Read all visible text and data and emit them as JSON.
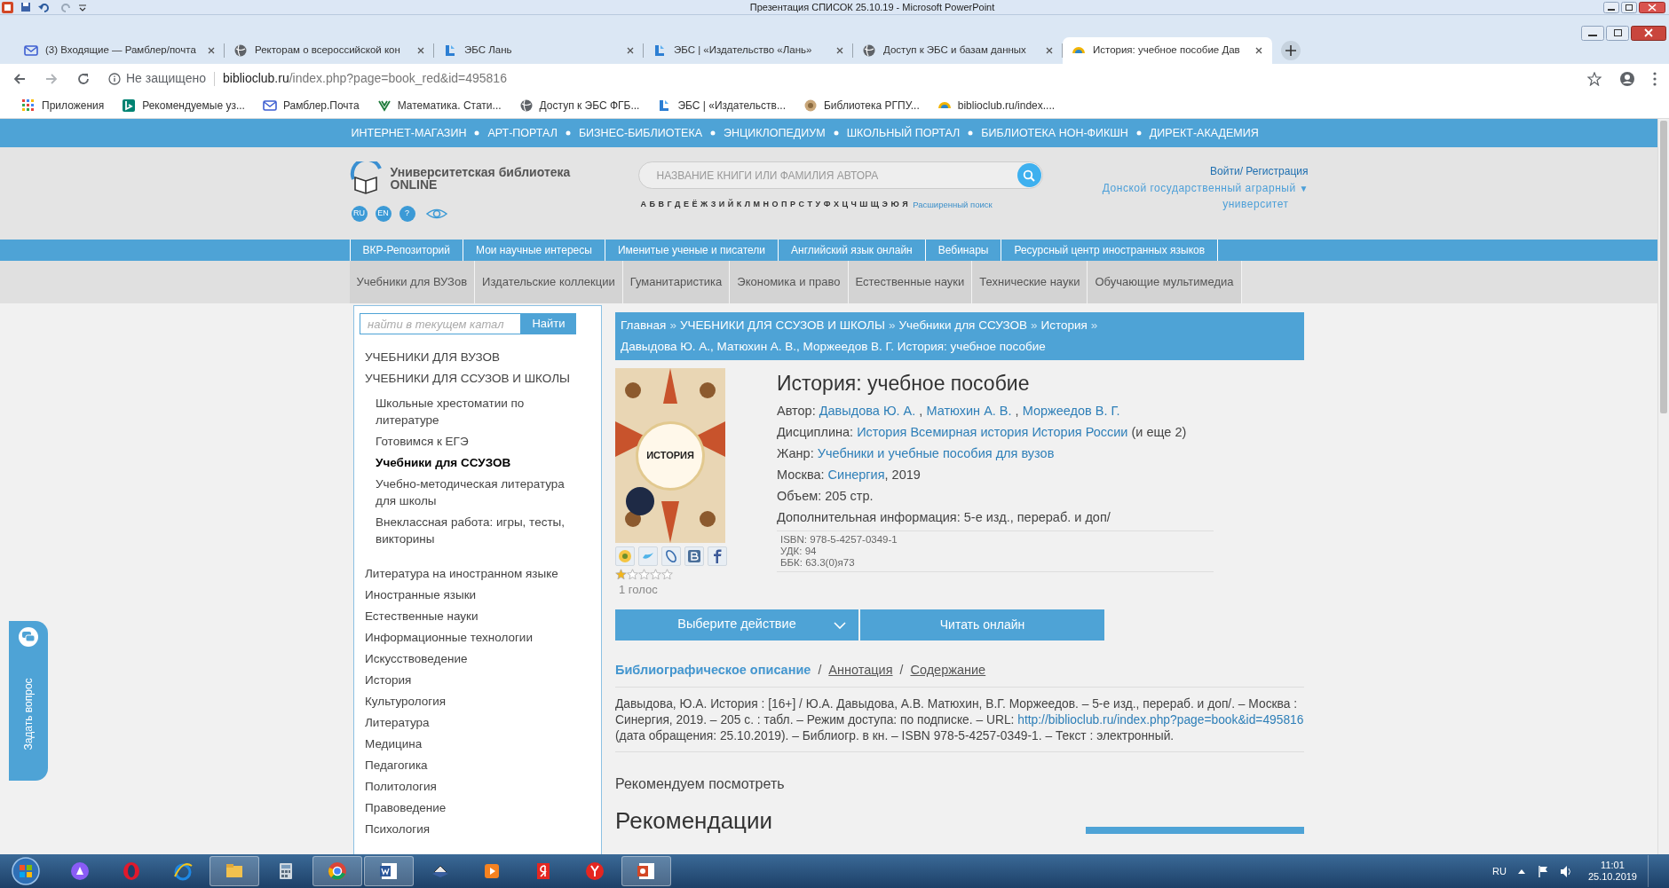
{
  "app_titlebar": {
    "title": "Презентация СПИСОК 25.10.19  -  Microsoft PowerPoint"
  },
  "browser": {
    "tabs": [
      {
        "title": "(3) Входящие — Рамблер/почта",
        "kind": "mail",
        "selected": false
      },
      {
        "title": "Ректорам о всероссийской кон",
        "kind": "globe",
        "selected": false
      },
      {
        "title": "ЭБС Лань",
        "kind": "lan",
        "selected": false
      },
      {
        "title": "ЭБС | «Издательство «Лань»",
        "kind": "lan",
        "selected": false
      },
      {
        "title": "Доступ к ЭБС и базам данных",
        "kind": "globe",
        "selected": false
      },
      {
        "title": "История: учебное пособие Дав",
        "kind": "biblio",
        "selected": true
      }
    ],
    "address": {
      "security": "Не защищено",
      "host": "biblioclub.ru",
      "path": "/index.php?page=book_red&id=495816"
    },
    "bookmarks": [
      {
        "label": "Приложения",
        "kind": "apps"
      },
      {
        "label": "Рекомендуемые уз...",
        "kind": "bing"
      },
      {
        "label": "Рамблер.Почта",
        "kind": "mail"
      },
      {
        "label": "Математика. Стати...",
        "kind": "math"
      },
      {
        "label": "Доступ к ЭБС ФГБ...",
        "kind": "globe"
      },
      {
        "label": "ЭБС | «Издательств...",
        "kind": "lan"
      },
      {
        "label": "Библиотека РГПУ...",
        "kind": "library"
      },
      {
        "label": "biblioclub.ru/index....",
        "kind": "biblio"
      }
    ]
  },
  "site": {
    "top_links": [
      "ИНТЕРНЕТ-МАГАЗИН",
      "АРТ-ПОРТАЛ",
      "БИЗНЕС-БИБЛИОТЕКА",
      "ЭНЦИКЛОПЕДИУМ",
      "ШКОЛЬНЫЙ ПОРТАЛ",
      "БИБЛИОТЕКА НОН-ФИКШН",
      "ДИРЕКТ-АКАДЕМИЯ"
    ],
    "logo": {
      "line1": "Университетская библиотека",
      "line2": "ONLINE"
    },
    "lang_buttons": [
      "RU",
      "EN",
      "?"
    ],
    "search": {
      "placeholder": "НАЗВАНИЕ КНИГИ ИЛИ ФАМИЛИЯ АВТОРА"
    },
    "alphabet": [
      "А",
      "Б",
      "В",
      "Г",
      "Д",
      "Е",
      "Ё",
      "Ж",
      "З",
      "И",
      "Й",
      "К",
      "Л",
      "М",
      "Н",
      "О",
      "П",
      "Р",
      "С",
      "Т",
      "У",
      "Ф",
      "Х",
      "Ц",
      "Ч",
      "Ш",
      "Щ",
      "Э",
      "Ю",
      "Я"
    ],
    "advanced_search": "Расширенный поиск",
    "login": "Войти/ Регистрация",
    "organization": {
      "line1": "Донской государственный аграрный",
      "caret": "▼",
      "line2": "университет"
    },
    "menu_primary": [
      "ВКР-Репозиторий",
      "Мои научные интересы",
      "Именитые ученые и писатели",
      "Английский язык онлайн",
      "Вебинары",
      "Ресурсный центр иностранных языков"
    ],
    "menu_secondary": [
      "Учебники для ВУЗов",
      "Издательские коллекции",
      "Гуманитаристика",
      "Экономика и право",
      "Естественные науки",
      "Технические науки",
      "Обучающие мультимедиа"
    ]
  },
  "sidebar": {
    "search": {
      "placeholder": "найти в текущем катал"
    },
    "search_button": "Найти",
    "categories": [
      {
        "label": "УЧЕБНИКИ ДЛЯ ВУЗОВ",
        "selected": false
      },
      {
        "label": "УЧЕБНИКИ ДЛЯ ССУЗОВ И ШКОЛЫ",
        "selected": false,
        "children": [
          {
            "label": "Школьные хрестоматии по литературе",
            "selected": false
          },
          {
            "label": "Готовимся к ЕГЭ",
            "selected": false
          },
          {
            "label": "Учебники для ССУЗОВ",
            "selected": true
          },
          {
            "label": "Учебно-методическая литература для школы",
            "selected": false
          },
          {
            "label": "Внеклассная работа: игры, тесты, викторины",
            "selected": false
          }
        ]
      },
      {
        "label": "Литература на иностранном языке",
        "selected": false
      },
      {
        "label": "Иностранные языки",
        "selected": false
      },
      {
        "label": "Естественные науки",
        "selected": false
      },
      {
        "label": "Информационные технологии",
        "selected": false
      },
      {
        "label": "Искусствоведение",
        "selected": false
      },
      {
        "label": "История",
        "selected": false
      },
      {
        "label": "Культурология",
        "selected": false
      },
      {
        "label": "Литература",
        "selected": false
      },
      {
        "label": "Медицина",
        "selected": false
      },
      {
        "label": "Педагогика",
        "selected": false
      },
      {
        "label": "Политология",
        "selected": false
      },
      {
        "label": "Правоведение",
        "selected": false
      },
      {
        "label": "Психология",
        "selected": false
      }
    ]
  },
  "breadcrumbs": {
    "separator": "»",
    "items": [
      "Главная",
      "УЧЕБНИКИ ДЛЯ ССУЗОВ И ШКОЛЫ",
      "Учебники для ССУЗОВ",
      "История",
      "Давыдова Ю. А., Матюхин А. В., Моржеедов В. Г. История: учебное пособие"
    ]
  },
  "book": {
    "cover_text": "ИСТОРИЯ",
    "title": "История: учебное пособие",
    "details": [
      {
        "label": "Автор:",
        "links": [
          "Давыдова Ю. А.",
          "Матюхин А. В.",
          "Моржеедов В. Г."
        ],
        "separator": " ,"
      },
      {
        "label": "Дисциплина:",
        "links": [
          "История",
          "Всемирная история",
          "История России"
        ],
        "suffix": " (и еще 2)"
      },
      {
        "label": "Жанр:",
        "links": [
          "Учебники и учебные пособия для вузов"
        ]
      },
      {
        "label": "Москва:",
        "links": [
          "Синергия"
        ],
        "suffix": ", 2019"
      },
      {
        "label": "Объем:",
        "value": "205 стр."
      },
      {
        "label": "Дополнительная информация:",
        "value": "5-е изд., перераб. и доп/"
      }
    ],
    "codes": [
      "ISBN: 978-5-4257-0349-1",
      "УДК: 94",
      "ББК: 63.3(0)я73"
    ],
    "stars": 1,
    "votes": "1 голос",
    "action_button": "Выберите действие",
    "read_button": "Читать онлайн"
  },
  "info_tabs": {
    "separator": "/",
    "items": [
      {
        "label": "Библиографическое описание",
        "selected": true
      },
      {
        "label": "Аннотация",
        "selected": false
      },
      {
        "label": "Содержание",
        "selected": false
      }
    ]
  },
  "citation": {
    "before": "Давыдова, Ю.А. История : [16+] / Ю.А. Давыдова, А.В. Матюхин, В.Г. Моржеедов. – 5-е изд., перераб. и доп/. – Москва : Синергия, 2019. – 205 с. : табл. – Режим доступа: по подписке. – URL: ",
    "link": "http://biblioclub.ru/index.php?page=book&id=495816",
    "after": " (дата обращения: 25.10.2019). – Библиогр. в кн. – ISBN 978-5-4257-0349-1. – Текст : электронный."
  },
  "recommend_label": "Рекомендуем посмотреть",
  "recommendations_heading": "Рекомендации",
  "feedback_tab": "Задать вопрос",
  "taskbar": {
    "apps": [
      {
        "kind": "alice",
        "running": false
      },
      {
        "kind": "opera",
        "running": false
      },
      {
        "kind": "ie",
        "running": false
      },
      {
        "kind": "explorer",
        "running": true
      },
      {
        "kind": "calculator",
        "running": false
      },
      {
        "kind": "chrome",
        "running": true
      },
      {
        "kind": "word",
        "running": true
      },
      {
        "kind": "books",
        "running": false
      },
      {
        "kind": "media",
        "running": false
      },
      {
        "kind": "yandex",
        "running": false
      },
      {
        "kind": "yabrowser",
        "running": false
      },
      {
        "kind": "powerpoint",
        "running": true
      }
    ],
    "language": "RU",
    "time": "11:01",
    "date": "25.10.2019"
  }
}
